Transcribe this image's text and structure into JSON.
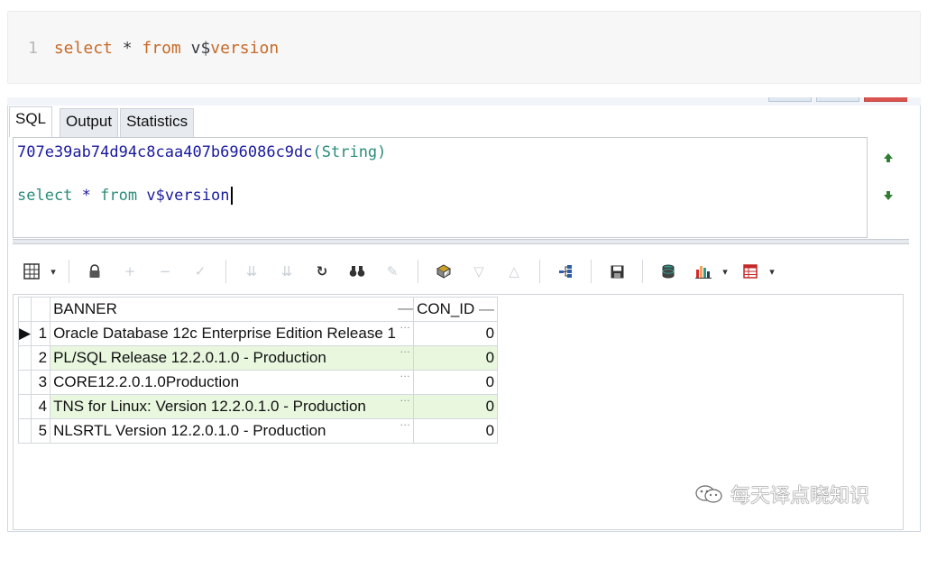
{
  "code_block": {
    "line_number": "1",
    "keyword_select": "select",
    "operator": "*",
    "keyword_from": "from",
    "table_prefix": "v$",
    "table_suffix": "version"
  },
  "tabs": [
    {
      "label": "SQL"
    },
    {
      "label": "Output"
    },
    {
      "label": "Statistics"
    }
  ],
  "editor": {
    "hash": "707e39ab74d94c8caa407b696086c9dc",
    "hash_type": "(String)",
    "sql_select": "select",
    "sql_star": "*",
    "sql_from": "from",
    "sql_table": "v$version"
  },
  "grid": {
    "columns": [
      "BANNER",
      "CON_ID"
    ],
    "rows": [
      {
        "num": "1",
        "banner": "Oracle Database 12c Enterprise Edition Release 1",
        "con_id": "0"
      },
      {
        "num": "2",
        "banner": "PL/SQL Release 12.2.0.1.0 - Production",
        "con_id": "0"
      },
      {
        "num": "3",
        "banner": "CORE12.2.0.1.0Production",
        "con_id": "0"
      },
      {
        "num": "4",
        "banner": "TNS for Linux: Version 12.2.0.1.0 - Production",
        "con_id": "0"
      },
      {
        "num": "5",
        "banner": "NLSRTL Version 12.2.0.1.0 - Production",
        "con_id": "0"
      }
    ]
  },
  "watermark": {
    "text": "每天译点晓知识"
  },
  "colors": {
    "keyword": "#c76b29",
    "alt_row": "#e9f7df",
    "sql_keyword": "#2a8c7a",
    "hash": "#1a1aa0"
  }
}
